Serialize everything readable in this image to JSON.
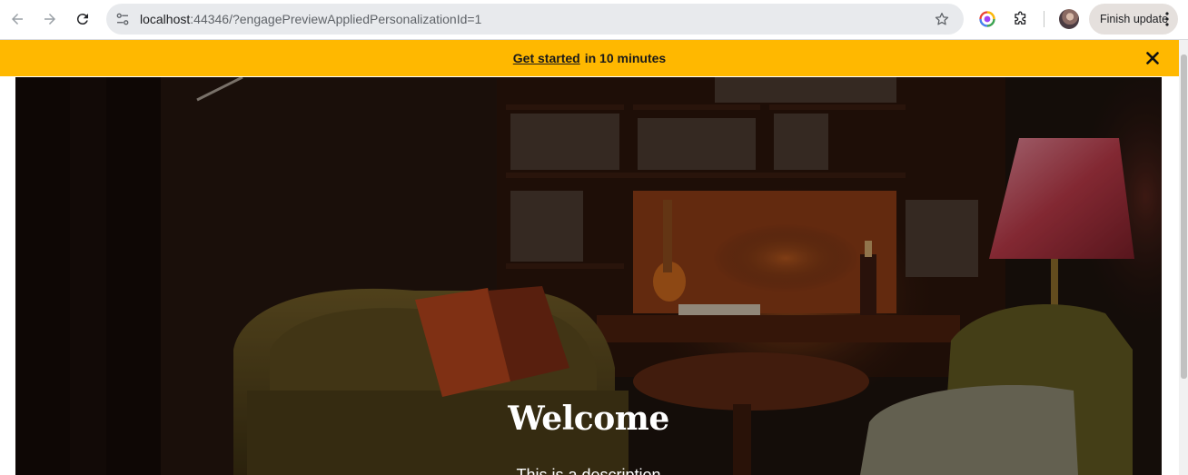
{
  "browser": {
    "url_host": "localhost",
    "url_rest": ":44346/?engagePreviewAppliedPersonalizationId=1",
    "finish_update_label": "Finish update",
    "icons": [
      "back-arrow-icon",
      "forward-arrow-icon",
      "reload-icon",
      "site-info-icon",
      "bookmark-star-icon",
      "color-extension-icon",
      "extensions-puzzle-icon",
      "profile-avatar",
      "more-vertical-icon"
    ]
  },
  "banner": {
    "link_text": "Get started",
    "text": "in 10 minutes",
    "background": "#ffb800"
  },
  "hero": {
    "title": "Welcome",
    "description": "This is a description"
  }
}
